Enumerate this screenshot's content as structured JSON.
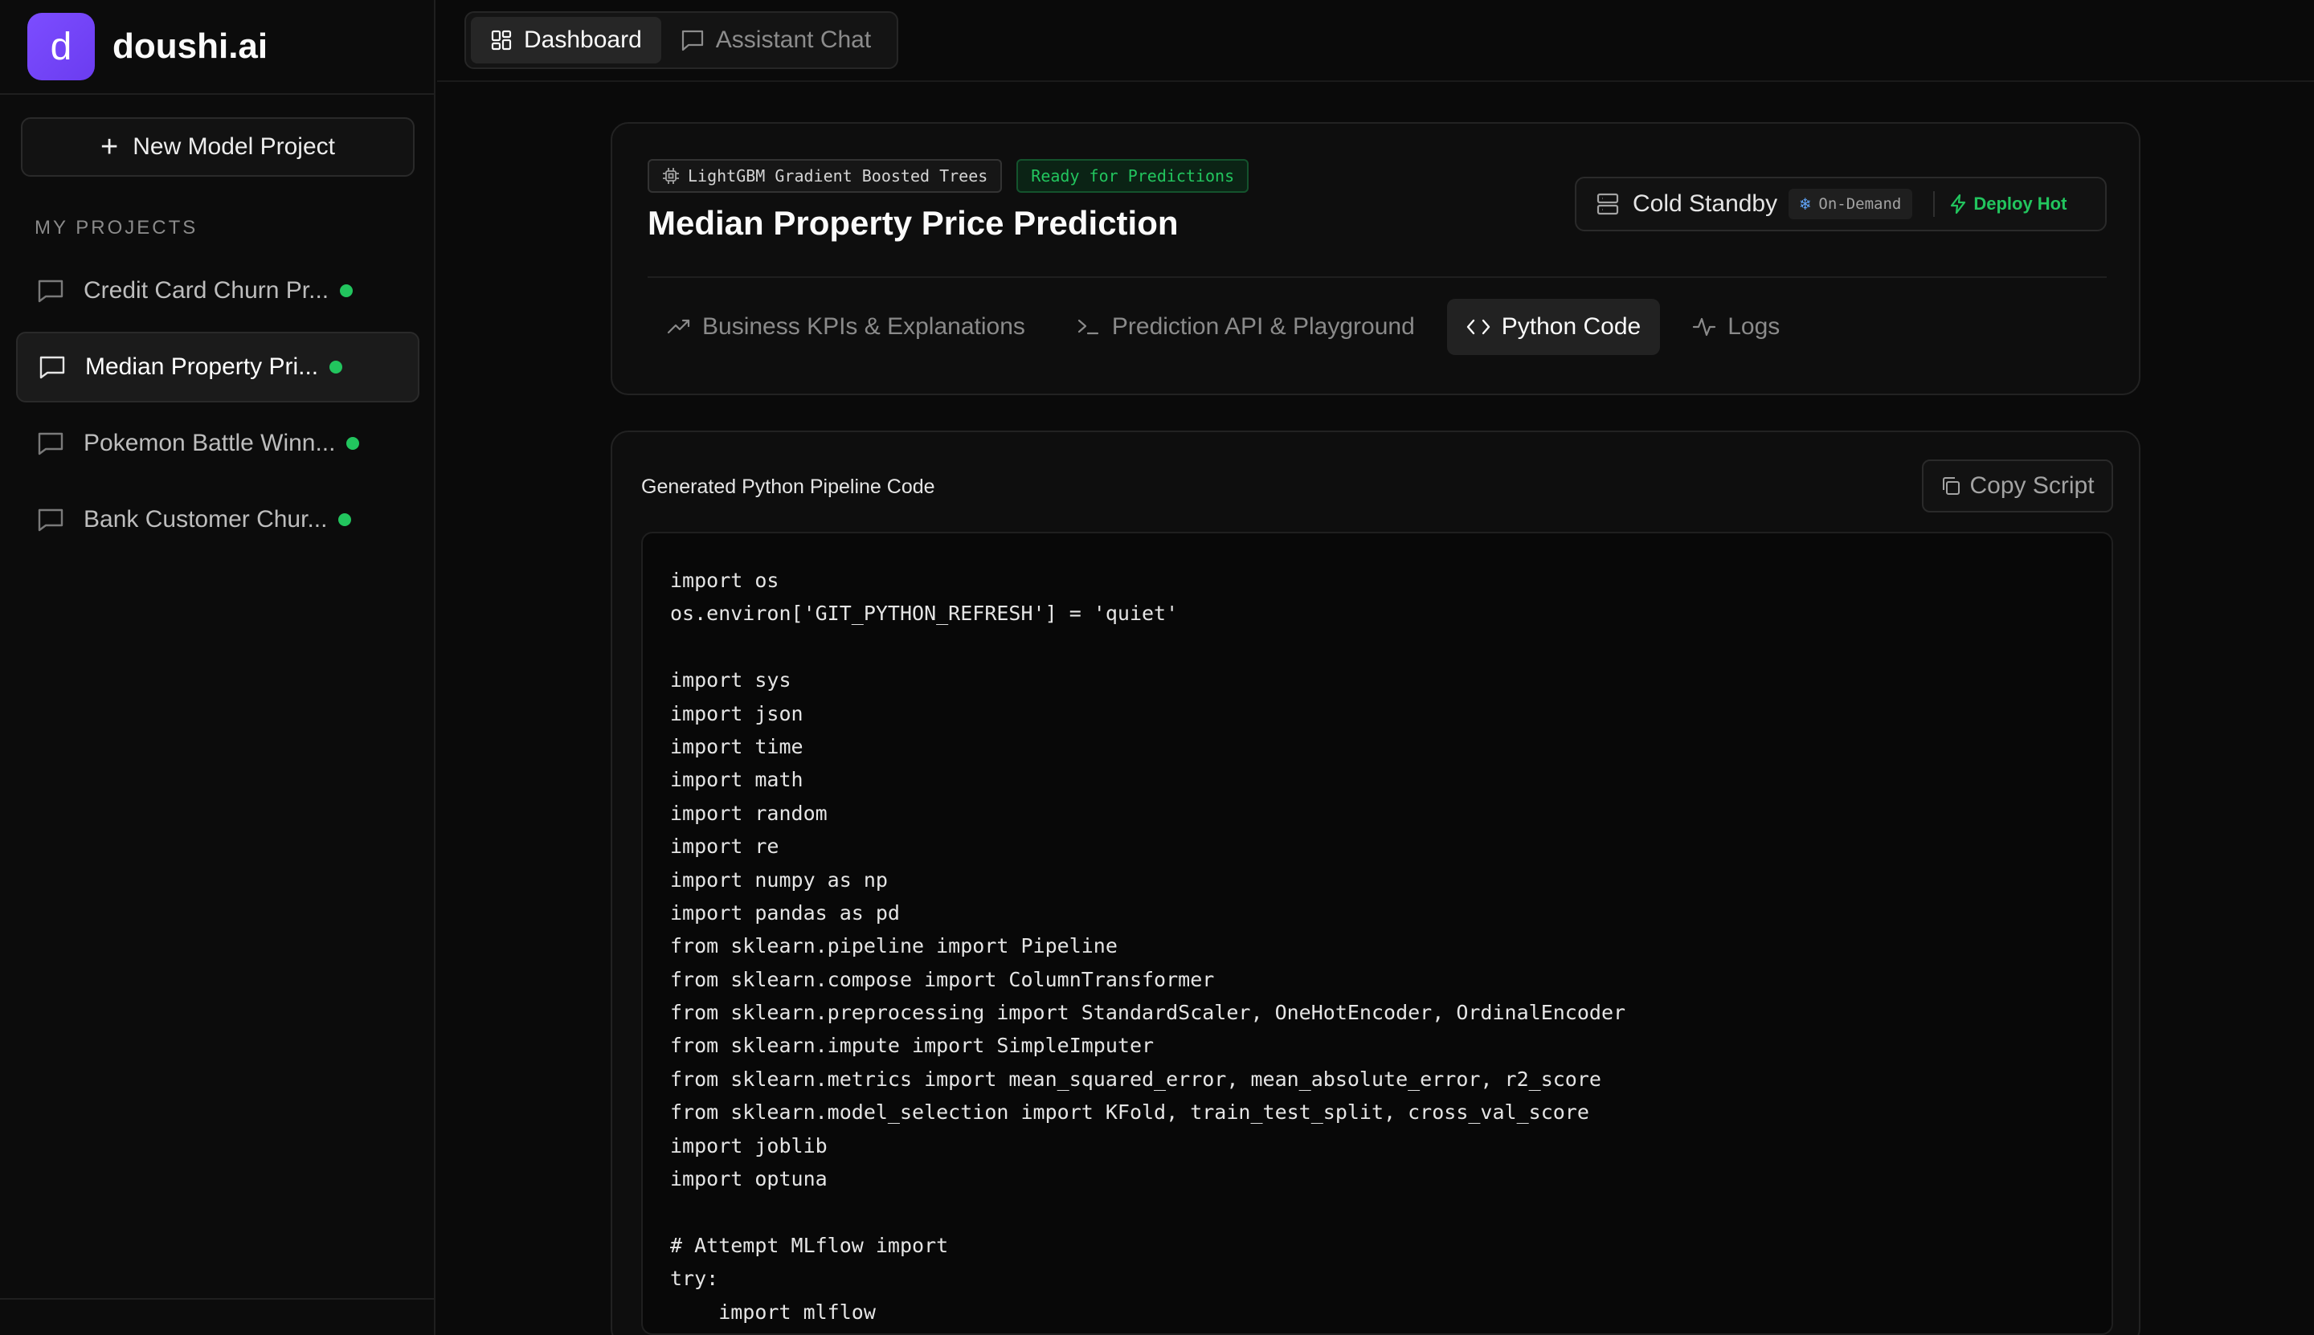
{
  "brand": {
    "logo_letter": "d",
    "name": "doushi.ai",
    "logo_color": "#7c4dff"
  },
  "sidebar": {
    "new_project_label": "New Model Project",
    "section_title": "MY PROJECTS",
    "projects": [
      {
        "label": "Credit Card Churn Pr...",
        "status_color": "#22c55e"
      },
      {
        "label": "Median Property Pri...",
        "status_color": "#22c55e"
      },
      {
        "label": "Pokemon Battle Winn...",
        "status_color": "#22c55e"
      },
      {
        "label": "Bank Customer Chur...",
        "status_color": "#22c55e"
      }
    ]
  },
  "top_tabs": {
    "dashboard": "Dashboard",
    "assistant_chat": "Assistant Chat"
  },
  "header": {
    "model_badge": "LightGBM Gradient Boosted Trees",
    "status_badge": "Ready for Predictions",
    "title": "Median Property Price Prediction",
    "deploy": {
      "status": "Cold Standby",
      "mode": "On-Demand",
      "action": "Deploy Hot"
    },
    "tabs": {
      "kpis": "Business KPIs & Explanations",
      "api": "Prediction API & Playground",
      "python": "Python Code",
      "logs": "Logs"
    }
  },
  "code": {
    "title": "Generated Python Pipeline Code",
    "copy_label": "Copy Script",
    "lines": [
      "import os",
      "os.environ['GIT_PYTHON_REFRESH'] = 'quiet'",
      "",
      "import sys",
      "import json",
      "import time",
      "import math",
      "import random",
      "import re",
      "import numpy as np",
      "import pandas as pd",
      "from sklearn.pipeline import Pipeline",
      "from sklearn.compose import ColumnTransformer",
      "from sklearn.preprocessing import StandardScaler, OneHotEncoder, OrdinalEncoder",
      "from sklearn.impute import SimpleImputer",
      "from sklearn.metrics import mean_squared_error, mean_absolute_error, r2_score",
      "from sklearn.model_selection import KFold, train_test_split, cross_val_score",
      "import joblib",
      "import optuna",
      "",
      "# Attempt MLflow import",
      "try:",
      "    import mlflow"
    ]
  }
}
